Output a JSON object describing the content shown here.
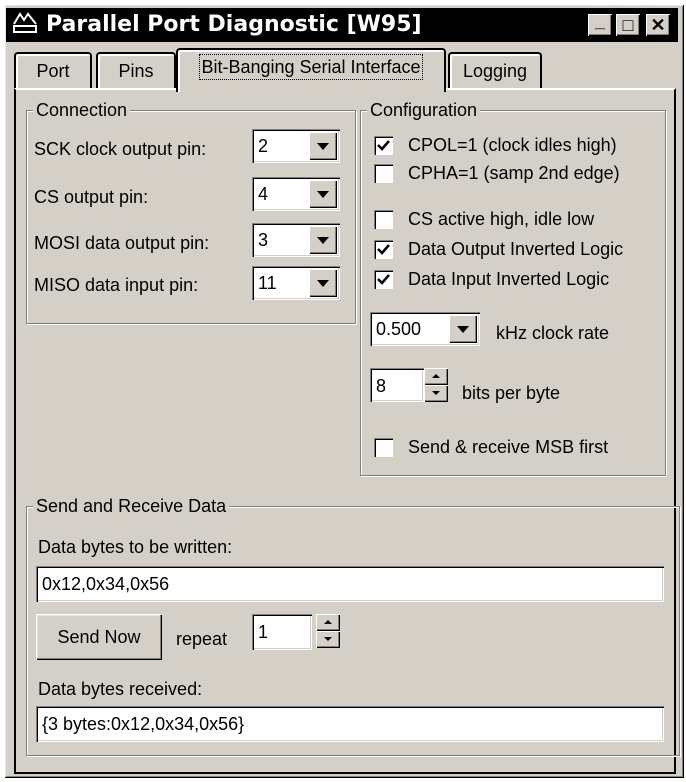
{
  "window": {
    "title": "Parallel Port Diagnostic [W95]",
    "minimize": "_",
    "maximize": "□",
    "close": "✕"
  },
  "tabs": [
    {
      "label": "Port"
    },
    {
      "label": "Pins"
    },
    {
      "label": "Bit-Banging Serial Interface",
      "active": true
    },
    {
      "label": "Logging"
    }
  ],
  "connection": {
    "legend": "Connection",
    "sck_label": "SCK clock output pin:",
    "sck_value": "2",
    "cs_label": "CS output pin:",
    "cs_value": "4",
    "mosi_label": "MOSI data output pin:",
    "mosi_value": "3",
    "miso_label": "MISO data input pin:",
    "miso_value": "11"
  },
  "configuration": {
    "legend": "Configuration",
    "cpol_label": "CPOL=1 (clock idles high)",
    "cpol_checked": true,
    "cpha_label": "CPHA=1 (samp 2nd edge)",
    "cpha_checked": false,
    "cs_active_label": "CS active high, idle low",
    "cs_active_checked": false,
    "dout_inv_label": "Data Output Inverted Logic",
    "dout_inv_checked": true,
    "din_inv_label": "Data Input Inverted Logic",
    "din_inv_checked": true,
    "clock_rate_value": "0.500",
    "clock_rate_label": "kHz clock rate",
    "bits_value": "8",
    "bits_label": "bits per byte",
    "msb_first_label": "Send & receive MSB first",
    "msb_first_checked": false
  },
  "send_receive": {
    "legend": "Send and Receive Data",
    "write_label": "Data bytes to be written:",
    "write_value": "0x12,0x34,0x56",
    "send_button": "Send Now",
    "repeat_label": "repeat",
    "repeat_value": "1",
    "received_label": "Data bytes received:",
    "received_value": "{3 bytes:0x12,0x34,0x56}"
  }
}
